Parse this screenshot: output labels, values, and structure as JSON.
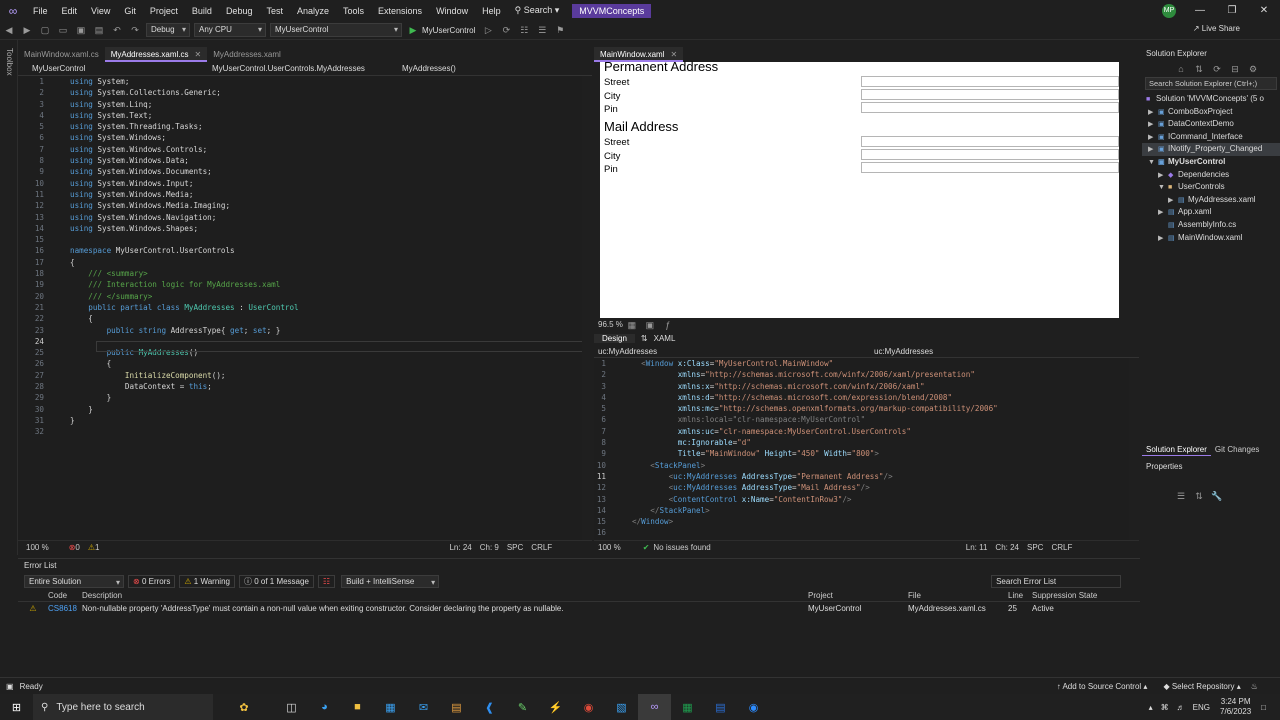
{
  "menu": {
    "items": [
      "File",
      "Edit",
      "View",
      "Git",
      "Project",
      "Build",
      "Debug",
      "Test",
      "Analyze",
      "Tools",
      "Extensions",
      "Window",
      "Help"
    ],
    "search": "Search",
    "app_name": "MVVMConcepts",
    "avatar": "MP"
  },
  "toolbar": {
    "config": "Debug",
    "platform": "Any CPU",
    "project": "MyUserControl",
    "run_label": "MyUserControl",
    "live_share": "Live Share"
  },
  "left_strip": "Toolbox",
  "code_tabs": [
    "MainWindow.xaml.cs",
    "MyAddresses.xaml.cs",
    "MyAddresses.xaml"
  ],
  "code_nav": {
    "project": "MyUserControl",
    "class": "MyUserControl.UserControls.MyAddresses",
    "member": "MyAddresses()"
  },
  "code_status": {
    "zoom": "100 %",
    "errors": "0",
    "warnings": "1",
    "ln": "Ln: 24",
    "ch": "Ch: 9",
    "enc": "SPC",
    "eol": "CRLF"
  },
  "design": {
    "tab": "MainWindow.xaml",
    "section1": "Permanent Address",
    "section2": "Mail Address",
    "labels": [
      "Street",
      "City",
      "Pin"
    ],
    "zoom": "96.5 %",
    "design_tab": "Design",
    "xaml_tab": "XAML",
    "nav_left": "uc:MyAddresses",
    "nav_right": "uc:MyAddresses"
  },
  "xaml_status": {
    "zoom": "100 %",
    "issues": "No issues found",
    "ln": "Ln: 11",
    "ch": "Ch: 24",
    "enc": "SPC",
    "eol": "CRLF"
  },
  "solution_explorer": {
    "title": "Solution Explorer",
    "search": "Search Solution Explorer (Ctrl+;)",
    "items": [
      "Solution 'MVVMConcepts' (5 o",
      "ComboBoxProject",
      "DataContextDemo",
      "ICommand_Interface",
      "INotify_Property_Changed",
      "MyUserControl",
      "Dependencies",
      "UserControls",
      "MyAddresses.xaml",
      "App.xaml",
      "AssemblyInfo.cs",
      "MainWindow.xaml"
    ],
    "tab1": "Solution Explorer",
    "tab2": "Git Changes"
  },
  "properties": {
    "title": "Properties"
  },
  "error_list": {
    "title": "Error List",
    "scope": "Entire Solution",
    "errors": "0 Errors",
    "warnings": "1 Warning",
    "messages": "0 of 1 Message",
    "build": "Build + IntelliSense",
    "search": "Search Error List",
    "headers": [
      "Code",
      "Description",
      "Project",
      "File",
      "Line",
      "Suppression State"
    ],
    "row": {
      "code": "CS8618",
      "description": "Non-nullable property 'AddressType' must contain a non-null value when exiting constructor. Consider declaring the property as nullable.",
      "project": "MyUserControl",
      "file": "MyAddresses.xaml.cs",
      "line": "25",
      "state": "Active"
    }
  },
  "statusbar": {
    "ready": "Ready",
    "source_control": "Add to Source Control",
    "repo": "Select Repository"
  },
  "taskbar": {
    "search": "Type here to search",
    "lang": "ENG",
    "time": "3:24 PM",
    "date": "7/6/2023"
  }
}
